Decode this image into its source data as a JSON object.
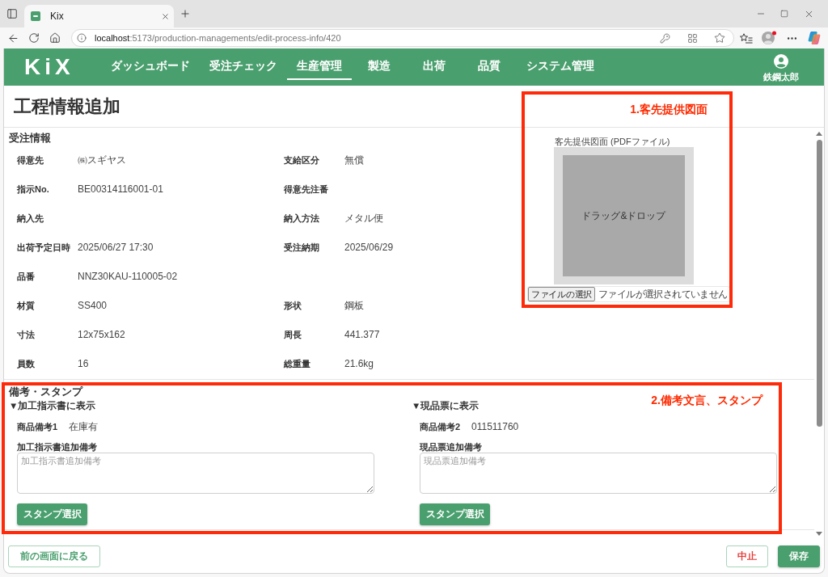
{
  "browser": {
    "tab": {
      "title": "Kix"
    },
    "url": {
      "host": "localhost",
      "path": ":5173/production-managements/edit-process-info/420"
    }
  },
  "app": {
    "logo": "KiX",
    "nav": [
      {
        "label": "ダッシュボード",
        "selected": false
      },
      {
        "label": "受注チェック",
        "selected": false
      },
      {
        "label": "生産管理",
        "selected": true
      },
      {
        "label": "製造",
        "selected": false
      },
      {
        "label": "出荷",
        "selected": false
      },
      {
        "label": "品質",
        "selected": false
      },
      {
        "label": "システム管理",
        "selected": false
      }
    ],
    "user": {
      "name": "鉄鋼太郎"
    }
  },
  "page": {
    "title": "工程情報追加"
  },
  "order_info": {
    "heading": "受注情報",
    "rows": [
      [
        {
          "label": "得意先",
          "value": "㈱スギヤス"
        },
        {
          "label": "支給区分",
          "value": "無償"
        }
      ],
      [
        {
          "label": "指示No.",
          "value": "BE00314116001-01"
        },
        {
          "label": "得意先注番"
        }
      ],
      [
        {
          "label": "納入先"
        },
        {
          "label": "納入方法",
          "value": "メタル便"
        }
      ],
      [
        {
          "label": "出荷予定日時",
          "value": "2025/06/27 17:30"
        },
        {
          "label": "受注納期",
          "value": "2025/06/29"
        }
      ],
      [
        {
          "label": "品番",
          "value": "NNZ30KAU-110005-02"
        }
      ],
      [
        {
          "label": "材質",
          "value": "SS400"
        },
        {
          "label": "形状",
          "value": "鋼板"
        }
      ],
      [
        {
          "label": "寸法",
          "value": "12x75x162"
        },
        {
          "label": "周長",
          "value": "441.377"
        }
      ],
      [
        {
          "label": "員数",
          "value": "16"
        },
        {
          "label": "総重量",
          "value": "21.6kg"
        }
      ]
    ]
  },
  "drawing_upload": {
    "label": "客先提供図面 (PDFファイル)",
    "drop_text": "ドラッグ&ドロップ",
    "file_button": "ファイルの選択",
    "file_status": "ファイルが選択されていません"
  },
  "remarks": {
    "heading": "備考・スタンプ",
    "columns": [
      {
        "title": "▼加工指示書に表示",
        "note_label": "商品備考1",
        "note_value": "在庫有",
        "field_label": "加工指示書追加備考",
        "placeholder": "加工指示書追加備考",
        "stamp_button": "スタンプ選択"
      },
      {
        "title": "▼現品票に表示",
        "note_label": "商品備考2",
        "note_value": "011511760",
        "field_label": "現品票追加備考",
        "placeholder": "現品票追加備考",
        "stamp_button": "スタンプ選択"
      }
    ]
  },
  "footer": {
    "back_button": "前の画面に戻る",
    "cancel_button": "中止",
    "save_button": "保存"
  },
  "annotations": [
    {
      "label": "1.客先提供図面"
    },
    {
      "label": "2.備考文言、スタンプ"
    }
  ]
}
